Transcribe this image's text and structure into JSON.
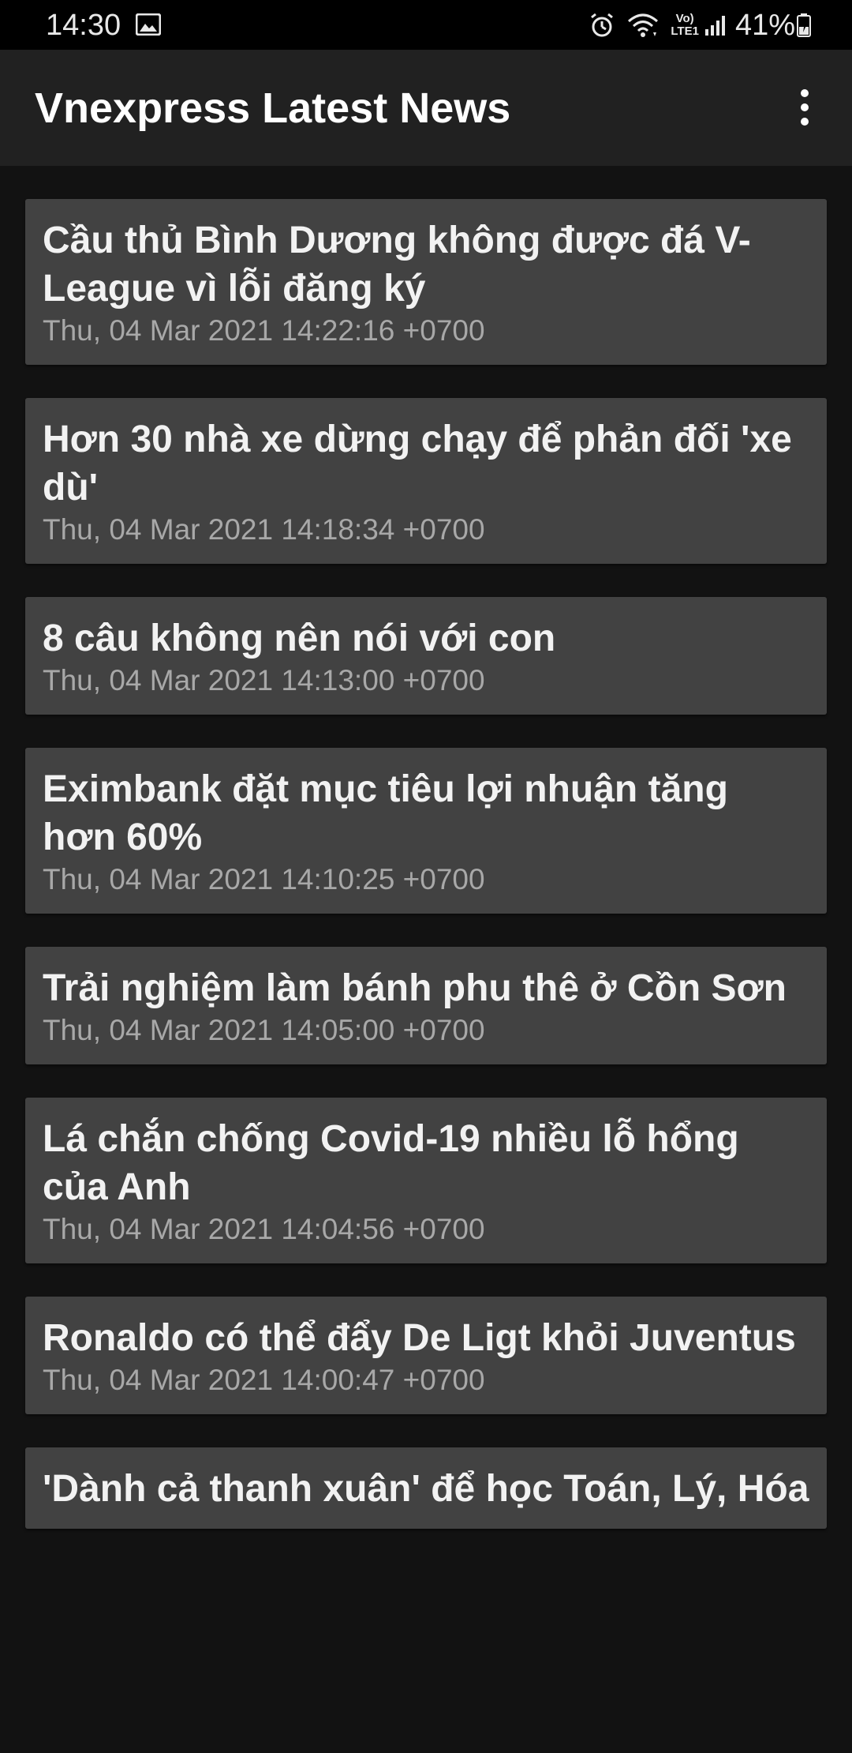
{
  "status_bar": {
    "time": "14:30",
    "battery_percent": "41%",
    "network_label_top": "Vo)",
    "network_label_bottom": "LTE1",
    "icons": [
      "image-icon",
      "alarm-icon",
      "wifi-icon",
      "volte-icon",
      "signal-icon",
      "battery-charging-icon"
    ]
  },
  "app_bar": {
    "title": "Vnexpress Latest News",
    "menu_icon": "overflow-menu-icon"
  },
  "news": [
    {
      "title": "Cầu thủ Bình Dương không được đá V-League vì lỗi đăng ký",
      "date": "Thu, 04 Mar 2021 14:22:16 +0700"
    },
    {
      "title": "Hơn 30 nhà xe dừng chạy để phản đối 'xe dù'",
      "date": "Thu, 04 Mar 2021 14:18:34 +0700"
    },
    {
      "title": "8 câu không nên nói với con",
      "date": "Thu, 04 Mar 2021 14:13:00 +0700"
    },
    {
      "title": "Eximbank đặt mục tiêu lợi nhuận tăng hơn 60%",
      "date": "Thu, 04 Mar 2021 14:10:25 +0700"
    },
    {
      "title": "Trải nghiệm làm bánh phu thê ở Cồn Sơn",
      "date": "Thu, 04 Mar 2021 14:05:00 +0700"
    },
    {
      "title": "Lá chắn chống Covid-19 nhiều lỗ hổng của Anh",
      "date": "Thu, 04 Mar 2021 14:04:56 +0700"
    },
    {
      "title": "Ronaldo có thể đẩy De Ligt khỏi Juventus",
      "date": "Thu, 04 Mar 2021 14:00:47 +0700"
    },
    {
      "title": "'Dành cả thanh xuân' để học Toán, Lý, Hóa",
      "date": ""
    }
  ],
  "colors": {
    "background": "#121212",
    "app_bar": "#212121",
    "card": "#424242",
    "title_text": "#f2f2f2",
    "date_text": "#a8a8a8"
  }
}
